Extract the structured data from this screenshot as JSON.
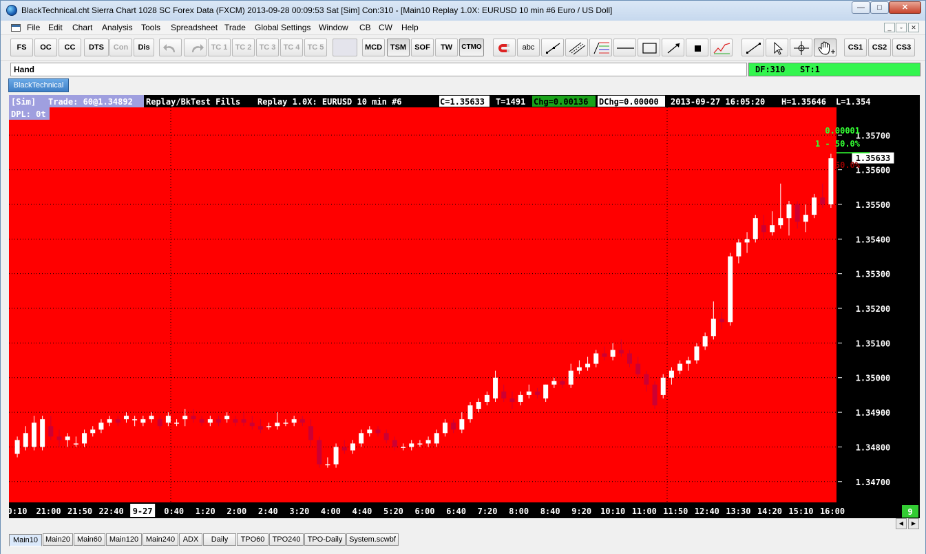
{
  "window": {
    "title": "BlackTechnical.cht  Sierra Chart 1028 SC Forex Data (FXCM) 2013-09-28  00:09:53 Sat [Sim]  Con:310 - [Main10  Replay 1.0X: EURUSD  10 min   #6  Euro / US Doll]",
    "min_label": "—",
    "max_label": "□",
    "close_label": "✕"
  },
  "menu": {
    "items": [
      "File",
      "Edit",
      "Chart",
      "Analysis",
      "Tools",
      "Spreadsheet",
      "Trade",
      "Global Settings",
      "Window",
      "CB",
      "CW",
      "Help"
    ],
    "mdi_min": "_",
    "mdi_restore": "▫",
    "mdi_close": "✕"
  },
  "toolbar": {
    "text_buttons": [
      "FS",
      "OC",
      "CC",
      "DTS",
      "Con",
      "Dis",
      "TC 1",
      "TC 2",
      "TC 3",
      "TC 4",
      "TC 5",
      "MCD",
      "TSM",
      "SOF",
      "TW",
      "CTMO",
      "abc",
      "CS1",
      "CS2",
      "CS3"
    ],
    "icons": [
      "undo-icon",
      "redo-icon",
      "magnet-icon",
      "ray-icon",
      "parallel-lines-icon",
      "fibonacci-icon",
      "horizontal-line-icon",
      "rectangle-icon",
      "arrow-icon",
      "marker-icon",
      "zigzag-icon",
      "line-icon",
      "pointer-icon",
      "crosshair-icon",
      "hand-icon"
    ]
  },
  "tool_info": {
    "current_tool": "Hand",
    "df": "DF:310",
    "st": "ST:1"
  },
  "chartbook_tab": "BlackTechnical",
  "chart_header": {
    "sim": "[Sim]",
    "trade": "Trade: 60@1.34892",
    "replay": "Replay/BkTest Fills",
    "symbol": "Replay 1.0X: EURUSD  10 min   #6",
    "close": "C=1.35633",
    "ticks": "T=1491",
    "chg": "Chg=0.00136",
    "dchg": "DChg=0.00000",
    "datetime": "2013-09-27 16:05:20",
    "high": "H=1.35646",
    "low": "L=1.354",
    "dpl": "DPL: 0t"
  },
  "chart_overlay": {
    "level_top": "0.00001",
    "level_mid": "1 - 50.0%",
    "level_low": "50.0%"
  },
  "colors": {
    "background": "#ff0000",
    "candle_up": "#ffffff",
    "candle_down": "#cc0033",
    "price_box": "#ffffff",
    "dchg_green": "#33cc33"
  },
  "chart_data": {
    "type": "candlestick",
    "symbol": "EURUSD",
    "interval": "10 min",
    "ylim": [
      1.3464,
      1.3578
    ],
    "y_ticks": [
      "1.35700",
      "1.35600",
      "1.35500",
      "1.35400",
      "1.35300",
      "1.35200",
      "1.35100",
      "1.35000",
      "1.34900",
      "1.34800",
      "1.34700"
    ],
    "current_price": "1.35633",
    "x_ticks": [
      "0:10",
      "21:00",
      "21:50",
      "22:40",
      "9-27",
      "0:40",
      "1:20",
      "2:00",
      "2:40",
      "3:20",
      "4:00",
      "4:40",
      "5:20",
      "6:00",
      "6:40",
      "7:20",
      "8:00",
      "8:40",
      "9:20",
      "10:10",
      "11:00",
      "11:50",
      "12:40",
      "13:30",
      "14:20",
      "15:10",
      "16:00"
    ],
    "bar_count_label": "9",
    "ohlc": [
      [
        1.3478,
        1.3483,
        1.3477,
        1.3482
      ],
      [
        1.348,
        1.3486,
        1.3479,
        1.3484
      ],
      [
        1.348,
        1.3489,
        1.3479,
        1.3487
      ],
      [
        1.348,
        1.3489,
        1.3479,
        1.3488
      ],
      [
        1.3486,
        1.3489,
        1.3482,
        1.3483
      ],
      [
        1.3483,
        1.3485,
        1.348,
        1.3482
      ],
      [
        1.3482,
        1.3484,
        1.348,
        1.3483
      ],
      [
        1.3481,
        1.3483,
        1.348,
        1.3481
      ],
      [
        1.3481,
        1.3485,
        1.348,
        1.3484
      ],
      [
        1.3484,
        1.3486,
        1.3483,
        1.3485
      ],
      [
        1.3485,
        1.3488,
        1.3484,
        1.3487
      ],
      [
        1.3487,
        1.3489,
        1.3486,
        1.3488
      ],
      [
        1.3488,
        1.3489,
        1.3486,
        1.3487
      ],
      [
        1.3488,
        1.349,
        1.3487,
        1.3489
      ],
      [
        1.3488,
        1.3489,
        1.3486,
        1.3488
      ],
      [
        1.3487,
        1.3489,
        1.3486,
        1.3488
      ],
      [
        1.3488,
        1.349,
        1.3487,
        1.3489
      ],
      [
        1.3488,
        1.3489,
        1.3485,
        1.3486
      ],
      [
        1.3487,
        1.349,
        1.3486,
        1.3489
      ],
      [
        1.3487,
        1.3488,
        1.3486,
        1.3487
      ],
      [
        1.3488,
        1.3491,
        1.3486,
        1.3489
      ],
      [
        1.3489,
        1.3491,
        1.3487,
        1.3488
      ],
      [
        1.3488,
        1.3489,
        1.3486,
        1.3487
      ],
      [
        1.3487,
        1.3489,
        1.3486,
        1.3488
      ],
      [
        1.3488,
        1.3489,
        1.3486,
        1.3487
      ],
      [
        1.3488,
        1.349,
        1.3487,
        1.3489
      ],
      [
        1.3488,
        1.3489,
        1.3486,
        1.3487
      ],
      [
        1.3488,
        1.349,
        1.3486,
        1.3487
      ],
      [
        1.3487,
        1.3489,
        1.3485,
        1.3486
      ],
      [
        1.3486,
        1.3488,
        1.3484,
        1.3485
      ],
      [
        1.3486,
        1.3487,
        1.3485,
        1.3486
      ],
      [
        1.3486,
        1.349,
        1.3485,
        1.3487
      ],
      [
        1.3487,
        1.3488,
        1.3486,
        1.3487
      ],
      [
        1.3487,
        1.3489,
        1.3486,
        1.3488
      ],
      [
        1.3488,
        1.3489,
        1.3486,
        1.3487
      ],
      [
        1.3486,
        1.3488,
        1.348,
        1.3482
      ],
      [
        1.3482,
        1.3483,
        1.3474,
        1.3475
      ],
      [
        1.3475,
        1.3477,
        1.3474,
        1.3475
      ],
      [
        1.3475,
        1.3481,
        1.3474,
        1.348
      ],
      [
        1.348,
        1.3482,
        1.3478,
        1.3479
      ],
      [
        1.3479,
        1.3482,
        1.3478,
        1.3481
      ],
      [
        1.3481,
        1.3485,
        1.348,
        1.3484
      ],
      [
        1.3484,
        1.3486,
        1.3483,
        1.3485
      ],
      [
        1.3485,
        1.3486,
        1.3483,
        1.3484
      ],
      [
        1.3484,
        1.3485,
        1.3481,
        1.3482
      ],
      [
        1.3482,
        1.3483,
        1.3479,
        1.348
      ],
      [
        1.348,
        1.3481,
        1.3479,
        1.348
      ],
      [
        1.348,
        1.3482,
        1.3479,
        1.3481
      ],
      [
        1.3481,
        1.3482,
        1.348,
        1.3481
      ],
      [
        1.3481,
        1.3483,
        1.348,
        1.3482
      ],
      [
        1.3481,
        1.3485,
        1.348,
        1.3484
      ],
      [
        1.3484,
        1.3488,
        1.3483,
        1.3487
      ],
      [
        1.3487,
        1.3488,
        1.3484,
        1.3485
      ],
      [
        1.3485,
        1.349,
        1.3484,
        1.3488
      ],
      [
        1.3488,
        1.3493,
        1.3487,
        1.3492
      ],
      [
        1.3491,
        1.3494,
        1.349,
        1.3493
      ],
      [
        1.3493,
        1.3496,
        1.3492,
        1.3495
      ],
      [
        1.3494,
        1.3502,
        1.3493,
        1.35
      ],
      [
        1.3496,
        1.3498,
        1.3493,
        1.3494
      ],
      [
        1.3494,
        1.3496,
        1.3491,
        1.3493
      ],
      [
        1.3493,
        1.3496,
        1.3492,
        1.3495
      ],
      [
        1.3495,
        1.3498,
        1.3494,
        1.3496
      ],
      [
        1.3496,
        1.3497,
        1.3494,
        1.3495
      ],
      [
        1.3494,
        1.3498,
        1.3493,
        1.3498
      ],
      [
        1.3498,
        1.35,
        1.3497,
        1.3499
      ],
      [
        1.3499,
        1.35,
        1.3497,
        1.3498
      ],
      [
        1.3498,
        1.3504,
        1.3497,
        1.3502
      ],
      [
        1.3502,
        1.3505,
        1.3501,
        1.3503
      ],
      [
        1.3503,
        1.3506,
        1.3502,
        1.3504
      ],
      [
        1.3504,
        1.3508,
        1.3503,
        1.3507
      ],
      [
        1.3507,
        1.3509,
        1.3505,
        1.3506
      ],
      [
        1.3506,
        1.351,
        1.3505,
        1.3508
      ],
      [
        1.3508,
        1.3511,
        1.3506,
        1.3507
      ],
      [
        1.3507,
        1.3508,
        1.3503,
        1.3504
      ],
      [
        1.3504,
        1.3506,
        1.35,
        1.3501
      ],
      [
        1.3501,
        1.3502,
        1.3496,
        1.3498
      ],
      [
        1.3498,
        1.3499,
        1.3491,
        1.3492
      ],
      [
        1.3495,
        1.3501,
        1.3494,
        1.35
      ],
      [
        1.35,
        1.3503,
        1.3498,
        1.3502
      ],
      [
        1.3502,
        1.3505,
        1.3501,
        1.3504
      ],
      [
        1.3504,
        1.3506,
        1.3502,
        1.3505
      ],
      [
        1.3505,
        1.351,
        1.3504,
        1.3509
      ],
      [
        1.3509,
        1.3513,
        1.3508,
        1.3512
      ],
      [
        1.3512,
        1.3522,
        1.3511,
        1.3517
      ],
      [
        1.3517,
        1.3519,
        1.3514,
        1.3516
      ],
      [
        1.3516,
        1.3536,
        1.3515,
        1.3535
      ],
      [
        1.3535,
        1.354,
        1.3533,
        1.3539
      ],
      [
        1.3539,
        1.3542,
        1.3536,
        1.354
      ],
      [
        1.354,
        1.3547,
        1.3539,
        1.3546
      ],
      [
        1.3544,
        1.3547,
        1.354,
        1.3542
      ],
      [
        1.3542,
        1.3548,
        1.3541,
        1.3544
      ],
      [
        1.3544,
        1.3556,
        1.3543,
        1.3546
      ],
      [
        1.3546,
        1.3551,
        1.3541,
        1.355
      ],
      [
        1.355,
        1.3551,
        1.3543,
        1.3545
      ],
      [
        1.3545,
        1.355,
        1.3542,
        1.3547
      ],
      [
        1.3547,
        1.3553,
        1.3546,
        1.3552
      ],
      [
        1.3552,
        1.3556,
        1.3549,
        1.355
      ],
      [
        1.355,
        1.35646,
        1.3549,
        1.35633
      ]
    ]
  },
  "bottom_tabs": [
    "Main10",
    "Main20",
    "Main60",
    "Main120",
    "Main240",
    "ADX",
    "Daily",
    "TPO60",
    "TPO240",
    "TPO-Daily",
    "System.scwbf"
  ],
  "active_bottom_tab": "Main10"
}
